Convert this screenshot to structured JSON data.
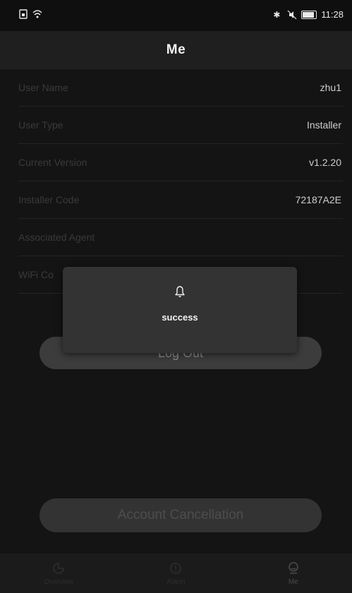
{
  "status_bar": {
    "left_icons": [
      "sim-icon",
      "wifi-icon"
    ],
    "right_icons": [
      "bluetooth-icon",
      "mute-icon",
      "battery-icon"
    ],
    "time": "11:28"
  },
  "header": {
    "title": "Me"
  },
  "info_rows": [
    {
      "label": "User Name",
      "value": "zhu1"
    },
    {
      "label": "User Type",
      "value": "Installer"
    },
    {
      "label": "Current Version",
      "value": "v1.2.20"
    },
    {
      "label": "Installer Code",
      "value": "72187A2E"
    },
    {
      "label": "Associated Agent",
      "value": ""
    },
    {
      "label": "WiFi Co",
      "value": ""
    }
  ],
  "buttons": {
    "logout": "Log Out",
    "account_cancellation": "Account Cancellation"
  },
  "toast": {
    "icon": "bell-icon",
    "message": "success"
  },
  "tabs": [
    {
      "label": "Overview",
      "icon": "overview-icon",
      "active": false
    },
    {
      "label": "Alarm",
      "icon": "alarm-icon",
      "active": false
    },
    {
      "label": "Me",
      "icon": "me-icon",
      "active": true
    }
  ]
}
